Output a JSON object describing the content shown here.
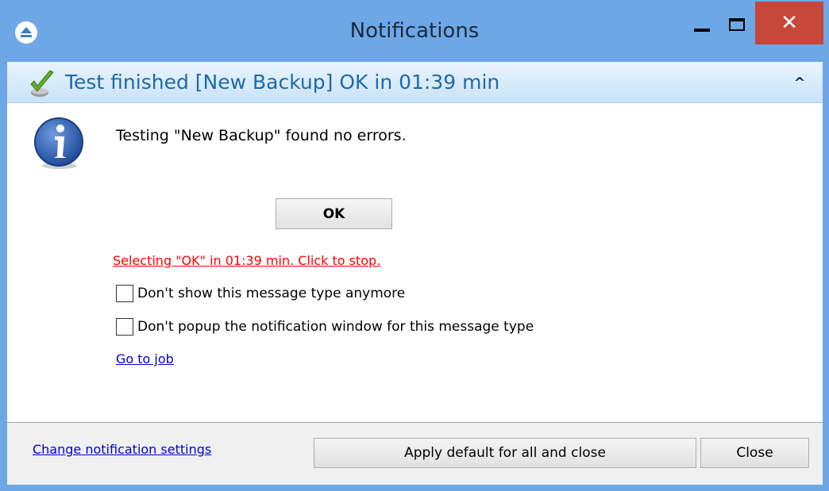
{
  "window": {
    "title": "Notifications",
    "close_glyph": "✕",
    "accent_color": "#6ea7e6",
    "close_color": "#c7473b"
  },
  "header": {
    "title": "Test finished [New Backup] OK in 01:39 min",
    "status_icon": "check-icon",
    "collapse_glyph": "^"
  },
  "message": {
    "icon": "info-icon",
    "text": "Testing \"New Backup\" found no errors.",
    "ok_label": "OK",
    "countdown": "Selecting \"OK\" in 01:39 min. Click to stop.",
    "countdown_color": "#ff0000"
  },
  "options": [
    {
      "label": "Don't show this message type anymore",
      "checked": false
    },
    {
      "label": "Don't popup the notification window for this message type",
      "checked": false
    }
  ],
  "goto_job_label": "Go to job",
  "footer": {
    "settings_link": "Change notification settings",
    "apply_label": "Apply default for all and close",
    "close_label": "Close"
  }
}
